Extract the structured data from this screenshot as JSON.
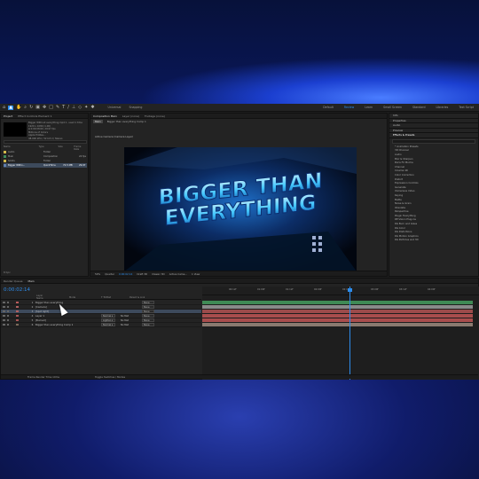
{
  "toolbar": {
    "icons": [
      "home-icon",
      "selection-icon",
      "hand-icon",
      "zoom-icon",
      "rotate-icon",
      "camera-icon",
      "pan-behind-icon",
      "rectangle-icon",
      "pen-icon",
      "text-icon",
      "brush-icon",
      "clone-icon",
      "eraser-icon",
      "roto-icon",
      "puppet-icon"
    ],
    "universal": "Universal",
    "snapping": "Snapping",
    "workspaces": [
      "Default",
      "Review",
      "Learn",
      "Small Screen",
      "Standard",
      "Libraries",
      "Text Script"
    ],
    "active_workspace": "Review"
  },
  "project": {
    "tab": "Project",
    "tab2": "Effect Controls Element 1",
    "info": [
      "Bigger Without everything.mp4 ▾ , used 1 time",
      "1920 x 1080 (1.00)",
      "Δ 0:00:08:00, 29.97 fps",
      "Millions of Colors",
      "Apple ProRes...",
      "48.000 kHz / 32 bit U / Stereo"
    ],
    "columns": [
      "Name",
      "Type",
      "Size",
      "Frame Rate"
    ],
    "rows": [
      {
        "name": "Audio",
        "type": "Folder",
        "size": "",
        "fps": "",
        "color": "#d2b84a"
      },
      {
        "name": "Main",
        "type": "Composition",
        "size": "",
        "fps": "24 fps",
        "color": "#3f8d5b"
      },
      {
        "name": "Solids",
        "type": "Folder",
        "size": "",
        "fps": "",
        "color": "#d2b84a"
      },
      {
        "name": "Bigger Witho...",
        "type": "QuickTime",
        "size": "72.5 MB",
        "fps": "29.97",
        "color": "#5f7fb0"
      }
    ],
    "footer": "8 bpc"
  },
  "composition": {
    "tab": "Composition Main",
    "tab2": "Layer (none)",
    "tab3": "Footage (none)",
    "main_btn": "Main",
    "crumb": "Bigger than everything Comp 1",
    "camera_label": "Active Camera (Camera Layer)",
    "zoom": "50%",
    "quality": "Quarter",
    "timecode": "0:00:02:14",
    "draft": "Draft 3D",
    "renderer": "Classic 3D",
    "camera": "Active Came...",
    "views": "1 View",
    "viewport_text_1": "BIGGER THAN",
    "viewport_text_2": "EVERYTHING"
  },
  "right": {
    "sections": [
      "Info",
      "Properties",
      "Audio",
      "Preview",
      "Effects & Presets"
    ],
    "search_placeholder": "",
    "effects": [
      "* Animation Presets",
      "3D Channel",
      "Audio",
      "Blur & Sharpen",
      "Boris FX Mocha",
      "Channel",
      "Cinema 4D",
      "Color Correction",
      "Distort",
      "Expression Controls",
      "Generate",
      "Immersive Video",
      "Keying",
      "Matte",
      "Noise & Grain",
      "Obsolete",
      "Perspective",
      "Plugin Everything",
      "RE:Vision Plug-ins",
      "RG Burn and Glass",
      "RG Color",
      "RG Distortions",
      "RG Motion Graphics",
      "RG Particles and 3D"
    ]
  },
  "timeline": {
    "tab": "Render Queue",
    "tab2": "Main",
    "timecode": "0:00:02:14",
    "headers": [
      "Layer Name",
      "Mode",
      "T TrkMat",
      "Parent & Link"
    ],
    "layers": [
      {
        "num": "1",
        "name": "Bigger than everything",
        "mode": "",
        "matte": "",
        "parent": "None",
        "color": "#bb5c5c",
        "track": "#3f8a55"
      },
      {
        "num": "2",
        "name": "[Camera]",
        "mode": "",
        "matte": "",
        "parent": "None",
        "color": "#b06060",
        "track": "#8a8a8a"
      },
      {
        "num": "3",
        "name": "[Spot light]",
        "mode": "",
        "matte": "",
        "parent": "None",
        "color": "#b06060",
        "track": "#9c4b4b"
      },
      {
        "num": "4",
        "name": "Layer 1",
        "mode": "Normal ▾",
        "matte": "No Mat",
        "parent": "None",
        "color": "#aa5555",
        "track": "#a84d4d"
      },
      {
        "num": "5",
        "name": "[Burned]",
        "mode": "Lighten ▾",
        "matte": "No Mat",
        "parent": "None",
        "color": "#aa5555",
        "track": "#a84d4d"
      },
      {
        "num": "6",
        "name": "Bigger than everything Comp 1",
        "mode": "Normal ▾",
        "matte": "No Mat",
        "parent": "None",
        "color": "#7a6a5a",
        "track": "#8a7a70"
      }
    ],
    "ruler": [
      "00:12f",
      "01:00f",
      "01:12f",
      "02:00f",
      "02:12f",
      "03:00f",
      "03:12f",
      "04:00f"
    ],
    "footer_left": "Frame Render Time  10ms",
    "footer_mid": "Toggle Switches / Modes"
  }
}
